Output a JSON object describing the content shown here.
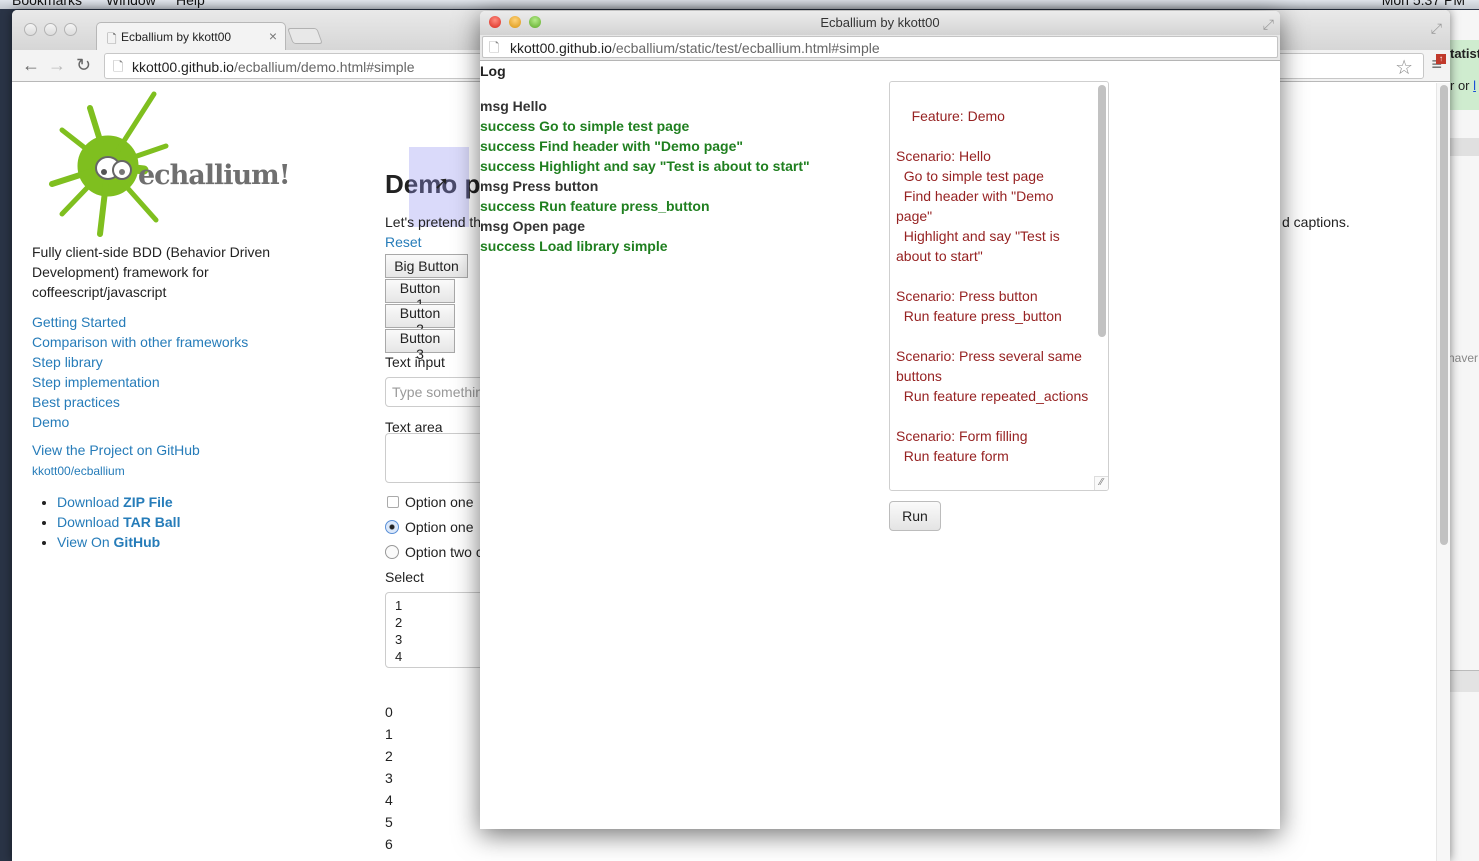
{
  "os_menubar": {
    "items": [
      "Bookmarks",
      "Window",
      "Help"
    ],
    "clock": "Mon 5:37 PM"
  },
  "background_window": {
    "heading_fragment": "tatist",
    "text_fragment": "r or ",
    "link_fragment": "l",
    "side_fragment": "naver"
  },
  "browser": {
    "tab_title": "Ecballium by kkott00",
    "tab_close": "×",
    "url_host": "kkott00.github.io",
    "url_path": "/ecballium/demo.html#simple",
    "icons": {
      "back": "←",
      "forward": "→",
      "reload": "↻",
      "star": "☆",
      "menu": "≡",
      "update_badge": "↑",
      "fullscreen": "⤢",
      "page": "🗋"
    }
  },
  "sidebar": {
    "logo_text": "echallium!",
    "description": "Fully client-side BDD (Behavior Driven Development) framework for coffeescript/javascript",
    "nav": [
      {
        "label": "Getting Started"
      },
      {
        "label": "Comparison with other frameworks"
      },
      {
        "label": "Step library"
      },
      {
        "label": "Step implementation"
      },
      {
        "label": "Best practices"
      },
      {
        "label": "Demo"
      }
    ],
    "github_link": "View the Project on GitHub",
    "github_repo": "kkott00/ecballium",
    "downloads": [
      {
        "prefix": "Download ",
        "bold": "ZIP File"
      },
      {
        "prefix": "Download ",
        "bold": "TAR Ball"
      },
      {
        "prefix": "View On ",
        "bold": "GitHub"
      }
    ]
  },
  "demo": {
    "heading": "Demo page",
    "intro": "Let's pretend th",
    "intro_tail": "d captions.",
    "reset": "Reset",
    "buttons": [
      "Big Button",
      "Button 1",
      "Button 2",
      "Button 3"
    ],
    "text_input_label": "Text input",
    "text_input_placeholder": "Type something…",
    "text_area_label": "Text area",
    "checkbox_label": "Option one",
    "checkbox_checked": false,
    "radios": [
      {
        "label": "Option one",
        "checked": true
      },
      {
        "label": "Option two c",
        "checked": false
      }
    ],
    "select_label": "Select",
    "select_options": [
      "1",
      "2",
      "3",
      "4"
    ],
    "number_list": [
      "0",
      "1",
      "2",
      "3",
      "4",
      "5",
      "6"
    ]
  },
  "popup": {
    "window_title": "Ecballium by kkott00",
    "url_host": "kkott00.github.io",
    "url_path": "/ecballium/static/test/ecballium.html#simple",
    "log_heading": "Log",
    "log": [
      {
        "type": "msg",
        "text": "msg Hello"
      },
      {
        "type": "success",
        "text": "success Go to simple test page"
      },
      {
        "type": "success",
        "text": "success Find header with \"Demo page\""
      },
      {
        "type": "success",
        "text": "success Highlight and say \"Test is about to start\""
      },
      {
        "type": "msg",
        "text": "msg Press button"
      },
      {
        "type": "success",
        "text": "success Run feature press_button"
      },
      {
        "type": "msg",
        "text": "msg Open page"
      },
      {
        "type": "success",
        "text": "success Load library simple"
      }
    ],
    "feature_text": "Feature: Demo\n\nScenario: Hello\n  Go to simple test page\n  Find header with \"Demo page\"\n  Highlight and say \"Test is about to start\"\n\nScenario: Press button\n  Run feature press_button\n\nScenario: Press several same buttons\n  Run feature repeated_actions\n\nScenario: Form filling\n  Run feature form",
    "run_label": "Run",
    "colors": {
      "success": "#1f7f1f",
      "msg": "#333333",
      "feature_text": "#962222",
      "link": "#267cb9"
    }
  }
}
